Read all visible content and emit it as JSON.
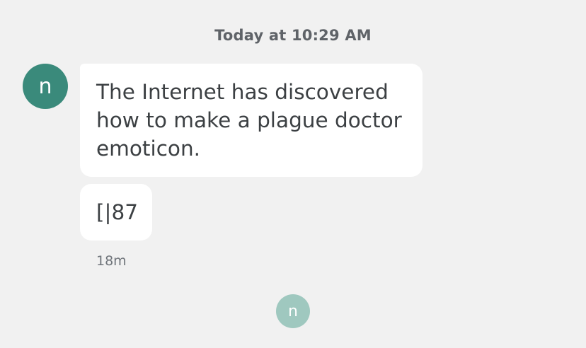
{
  "conversation": {
    "timestamp_header": "Today at 10:29 AM",
    "sender": {
      "avatar_letter": "n",
      "avatar_color": "#3a8a7b"
    },
    "messages": [
      {
        "text": "The Internet has discovered how to make a plague doctor emoticon."
      },
      {
        "text": "[|87"
      }
    ],
    "message_time": "18m",
    "read_receipt": {
      "avatar_letter": "n",
      "avatar_color": "#9fc8bf"
    }
  },
  "colors": {
    "background": "#f1f1f1",
    "bubble": "#ffffff",
    "text": "#3c4043",
    "muted_text": "#5f6368"
  }
}
